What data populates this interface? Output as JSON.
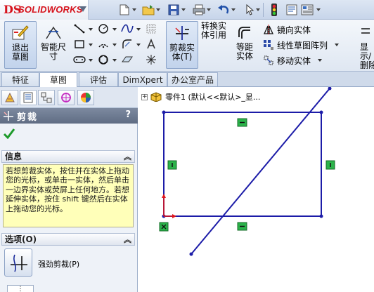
{
  "app": {
    "logo_text": "SOLIDWORKS",
    "logo_mark": "DS"
  },
  "quick_access": [
    {
      "name": "new-document-icon"
    },
    {
      "name": "open-folder-icon"
    },
    {
      "name": "save-icon"
    },
    {
      "name": "print-icon"
    },
    {
      "name": "undo-icon"
    },
    {
      "name": "select-arrow-icon"
    },
    {
      "name": "traffic-light-icon"
    },
    {
      "name": "options-icon"
    }
  ],
  "ribbon": {
    "exit_sketch": "退出草图",
    "smart_dimension": "智能尺寸",
    "trim_entities": "剪裁实体(T)",
    "convert_entities": "转换实体引用",
    "offset_entities": "等距实体",
    "mirror_entities": "镜向实体",
    "linear_pattern": "线性草图阵列",
    "move_entities": "移动实体",
    "display_delete": "显示/删除"
  },
  "tabs": [
    {
      "label": "特征",
      "active": false
    },
    {
      "label": "草图",
      "active": true
    },
    {
      "label": "评估",
      "active": false
    },
    {
      "label": "DimXpert",
      "active": false
    },
    {
      "label": "办公室产品",
      "active": false
    }
  ],
  "property_manager": {
    "title": "剪裁",
    "help": "?",
    "info_header": "信息",
    "info_text": "若想剪裁实体，按住并在实体上拖动您的光标，或单击一实体，然后单击一边界实体或荧屏上任何地方。若想延伸实体，按住 shift 键然后在实体上拖动您的光标。",
    "options_header": "选项(O)",
    "option_power_trim": "强劲剪裁(P)"
  },
  "feature_tree": {
    "root": "零件1 (默认<<默认>_显..."
  },
  "colors": {
    "sketch_line": "#1c1ca8",
    "relation_green": "#2bb34a",
    "origin_red": "#e0161c",
    "info_bg": "#ffffb9",
    "logo_red": "#d6121b"
  }
}
